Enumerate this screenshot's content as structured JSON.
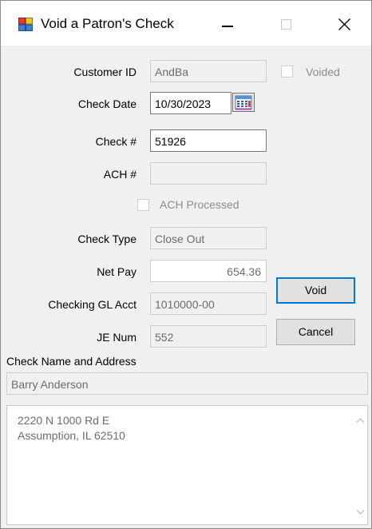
{
  "window": {
    "title": "Void a Patron's Check",
    "icon": "window-form-icon",
    "controls": [
      "minimize-icon",
      "maximize-icon",
      "close-icon"
    ]
  },
  "form": {
    "customer_id": {
      "label": "Customer ID",
      "value": "AndBa"
    },
    "voided": {
      "label": "Voided",
      "checked": false
    },
    "check_date": {
      "label": "Check Date",
      "value": "10/30/2023",
      "picker_icon": "calendar-icon"
    },
    "check_number": {
      "label": "Check #",
      "value": "51926"
    },
    "ach_number": {
      "label": "ACH #",
      "value": ""
    },
    "ach_processed": {
      "label": "ACH Processed",
      "checked": false
    },
    "check_type": {
      "label": "Check Type",
      "value": "Close Out"
    },
    "net_pay": {
      "label": "Net Pay",
      "value": "654.36"
    },
    "checking_gl_acct": {
      "label": "Checking GL Acct",
      "value": "1010000-00"
    },
    "je_num": {
      "label": "JE Num",
      "value": "552"
    }
  },
  "buttons": {
    "void": "Void",
    "cancel": "Cancel"
  },
  "address_section": {
    "label": "Check Name and Address",
    "name": "Barry Anderson",
    "lines": [
      "2220 N 1000 Rd E",
      "Assumption, IL 62510"
    ]
  }
}
